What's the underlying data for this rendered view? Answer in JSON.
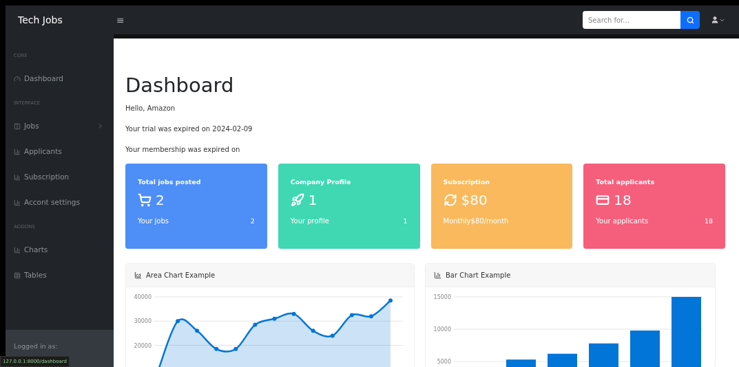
{
  "navbar": {
    "brand": "Tech Jobs",
    "menu_icon": "≡",
    "search": {
      "placeholder": "Search for..."
    }
  },
  "sidebar": {
    "items": [
      {
        "kind": "heading",
        "label": "CORE"
      },
      {
        "kind": "link",
        "label": "Dashboard"
      },
      {
        "kind": "heading",
        "label": "INTERFACE"
      },
      {
        "kind": "link",
        "label": "Jobs",
        "expanded": false
      },
      {
        "kind": "link",
        "label": "Applicants"
      },
      {
        "kind": "link",
        "label": "Subscription"
      },
      {
        "kind": "link",
        "label": "Accont settings"
      },
      {
        "kind": "heading",
        "label": "ADDONS"
      },
      {
        "kind": "link",
        "label": "Charts"
      },
      {
        "kind": "link",
        "label": "Tables"
      }
    ],
    "footer": {
      "label": "Logged in as:"
    }
  },
  "status_url": "127.0.0.1:8000/dashboard",
  "page": {
    "title": "Dashboard",
    "lines": [
      "Hello, Amazon",
      "Your trial was expired on 2024-02-09",
      "Your membership was expired on"
    ]
  },
  "cards": [
    {
      "title": "Total jobs posted",
      "value": "2",
      "link": "Your jobs",
      "count": "2",
      "color": "#4e8ef7"
    },
    {
      "title": "Company Profile",
      "value": "1",
      "link": "Your profile",
      "count": "1",
      "color": "#3fd8b3"
    },
    {
      "title": "Subscription",
      "value": "$80",
      "link": "Monthly$80/month",
      "color": "#f9b95c"
    },
    {
      "title": "Total applicants",
      "value": "18",
      "link": "Your applicants",
      "count": "18",
      "color": "#f65f7c"
    }
  ],
  "charts": [
    {
      "title": "Area Chart Example",
      "chart_data": {
        "type": "area",
        "ylim": [
          0,
          40000
        ],
        "yticks": [
          20000,
          30000,
          40000
        ],
        "series": [
          {
            "color": "#0275d8",
            "values": [
              10000,
              30000,
              26000,
              18500,
              18500,
              28500,
              31000,
              33000,
              26000,
              24000,
              32500,
              32000,
              38500
            ]
          }
        ]
      }
    },
    {
      "title": "Bar Chart Example",
      "chart_data": {
        "type": "bar",
        "ylim": [
          0,
          15000
        ],
        "yticks": [
          5000,
          10000,
          15000
        ],
        "series": [
          {
            "color": "#0275d8",
            "values": [
              null,
              5300,
              6200,
              7800,
              9800,
              15000
            ]
          }
        ]
      }
    }
  ]
}
